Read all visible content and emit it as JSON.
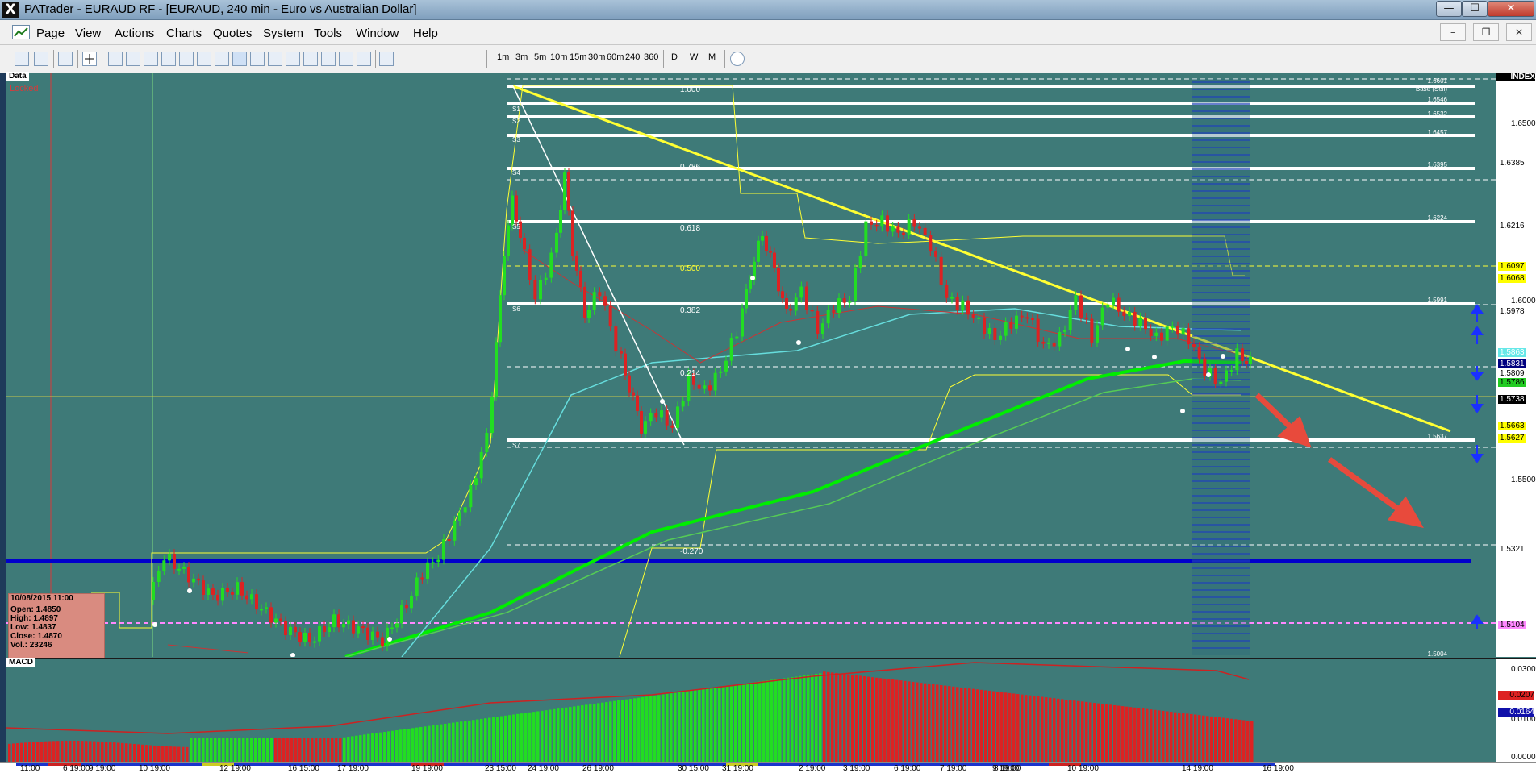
{
  "window": {
    "app_icon": "X",
    "title": "PATrader - EURAUD RF - [EURAUD, 240 min - Euro vs Australian Dollar]",
    "controls": {
      "minimize": "—",
      "maximize": "☐",
      "close": "✕"
    }
  },
  "menu": {
    "items": [
      "Page",
      "View",
      "Actions",
      "Charts",
      "Quotes",
      "System",
      "Tools",
      "Window",
      "Help"
    ],
    "mdi_controls": {
      "minimize": "–",
      "restore": "❐",
      "close": "✕"
    }
  },
  "toolbar": {
    "timeframes": [
      "1m",
      "3m",
      "5m",
      "10m",
      "15m",
      "30m",
      "60m",
      "240",
      "360",
      "D",
      "W",
      "M"
    ]
  },
  "chart": {
    "data_label": "Data",
    "locked_label": "Locked",
    "index_label": "INDEX",
    "macd_label": "MACD",
    "fib_labels": [
      "1.000",
      "0.786",
      "0.618",
      "0.500",
      "0.382",
      "0.214",
      "-0.270"
    ],
    "level_labels": {
      "base": "Base (Sell)",
      "s1": "S1",
      "s2": "S2",
      "s3": "S3",
      "s4": "S4",
      "s5": "S5",
      "s6": "S6",
      "s7": "S7",
      "p16601": "1.6601",
      "p16546": "1.6546",
      "p16532": "1.6532",
      "p16457": "1.6457",
      "p16395": "1.6395",
      "p16224": "1.6224",
      "p15991": "1.5991",
      "p15637": "1.5637",
      "p15004": "1.5004"
    },
    "info_box": {
      "date": "10/08/2015 11:00",
      "open": "Open: 1.4850",
      "high": "High: 1.4897",
      "low": "Low: 1.4837",
      "close": "Close: 1.4870",
      "volume": "Vol.: 23246"
    },
    "price_axis": [
      "1.6500",
      "1.6000",
      "1.5500"
    ],
    "price_tags": [
      {
        "text": "1.6385",
        "bg": "#ffffff",
        "fg": "#000000"
      },
      {
        "text": "1.6216",
        "bg": "#ffffff",
        "fg": "#000000"
      },
      {
        "text": "1.6097",
        "bg": "#ffff00",
        "fg": "#000000"
      },
      {
        "text": "1.6068",
        "bg": "#ffff00",
        "fg": "#000000"
      },
      {
        "text": "1.5978",
        "bg": "#ffffff",
        "fg": "#000000"
      },
      {
        "text": "1.5863",
        "bg": "#66e8e8",
        "fg": "#ffffff"
      },
      {
        "text": "1.5831",
        "bg": "#000080",
        "fg": "#ffffff"
      },
      {
        "text": "1.5809",
        "bg": "#ffffff",
        "fg": "#000000"
      },
      {
        "text": "1.5786",
        "bg": "#22cc22",
        "fg": "#000000"
      },
      {
        "text": "1.5738",
        "bg": "#000000",
        "fg": "#ffffff"
      },
      {
        "text": "1.5663",
        "bg": "#ffff00",
        "fg": "#000000"
      },
      {
        "text": "1.5627",
        "bg": "#ffff00",
        "fg": "#000000"
      },
      {
        "text": "1.5321",
        "bg": "#ffffff",
        "fg": "#000000"
      },
      {
        "text": "1.5104",
        "bg": "#ff88ff",
        "fg": "#000000"
      }
    ],
    "macd_axis": [
      "0.0300",
      "0.0207",
      "0.0100",
      "0.0000"
    ],
    "macd_tags": [
      {
        "text": "0.0207",
        "bg": "#dd2222",
        "fg": "#000000"
      },
      {
        "text": "0.0164",
        "bg": "#1010aa",
        "fg": "#ffffff"
      }
    ],
    "time_labels": [
      "11:00",
      "6 19:00",
      "9 19:00",
      "10 19:00",
      "12 19:00",
      "16 15:00",
      "17 19:00",
      "19 19:00",
      "23 15:00",
      "24 19:00",
      "26 19:00",
      "30 15:00",
      "31 19:00",
      "2 19:00",
      "3 19:00",
      "6 19:00",
      "7 19:00",
      "8 19:00",
      "9 19:00",
      "10 19:00",
      "14 19:00",
      "16 19:00"
    ]
  },
  "colors": {
    "chart_bg": "#3e7a78",
    "bull_candle": "#22dd22",
    "bear_candle": "#dd2222",
    "trendline": "#ffff33",
    "support_line": "#0000cc",
    "arrow": "#e84a3c"
  }
}
